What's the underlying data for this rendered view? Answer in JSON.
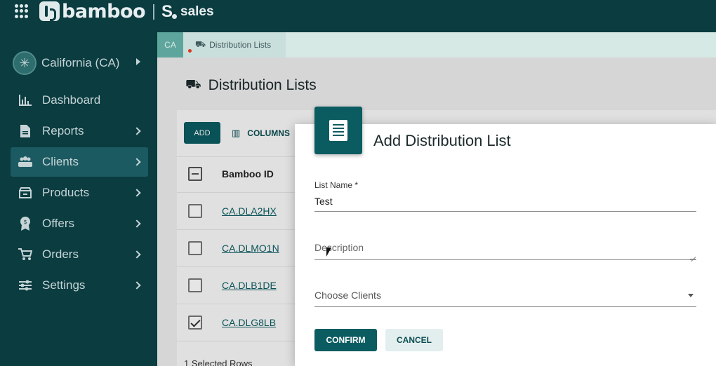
{
  "app": {
    "brand": "bamboo",
    "product_s": "S",
    "product_name": "sales"
  },
  "sidebar": {
    "state": {
      "label": "California (CA)",
      "icon": "cannabis-leaf-icon"
    },
    "items": [
      {
        "label": "Dashboard",
        "icon": "bar-chart-icon",
        "chevron": false,
        "active": false
      },
      {
        "label": "Reports",
        "icon": "document-icon",
        "chevron": true,
        "active": false
      },
      {
        "label": "Clients",
        "icon": "group-icon",
        "chevron": true,
        "active": true
      },
      {
        "label": "Products",
        "icon": "storefront-icon",
        "chevron": true,
        "active": false
      },
      {
        "label": "Offers",
        "icon": "badge-icon",
        "chevron": true,
        "active": false
      },
      {
        "label": "Orders",
        "icon": "cart-icon",
        "chevron": true,
        "active": false
      },
      {
        "label": "Settings",
        "icon": "sliders-icon",
        "chevron": true,
        "active": false
      }
    ]
  },
  "breadcrumb": {
    "state_code": "CA",
    "tab_label": "Distribution Lists"
  },
  "page": {
    "title": "Distribution Lists",
    "add_label": "ADD",
    "columns_label": "COLUMNS",
    "column_header": "Bamboo ID",
    "rows": [
      {
        "id": "CA.DLA2HX",
        "checked": false
      },
      {
        "id": "CA.DLMO1N",
        "checked": false
      },
      {
        "id": "CA.DLB1DE",
        "checked": false
      },
      {
        "id": "CA.DLG8LB",
        "checked": true
      }
    ],
    "footer": "1 Selected Rows"
  },
  "dialog": {
    "title": "Add Distribution List",
    "list_name_label": "List Name *",
    "list_name_value": "Test",
    "description_placeholder": "Description",
    "clients_placeholder": "Choose Clients",
    "confirm_label": "CONFIRM",
    "cancel_label": "CANCEL"
  },
  "colors": {
    "primary": "#0b5c61",
    "header_bg": "#0a3c40",
    "breadcrumb_bg": "#d7e9e5",
    "status_dot": "#d9361f"
  }
}
